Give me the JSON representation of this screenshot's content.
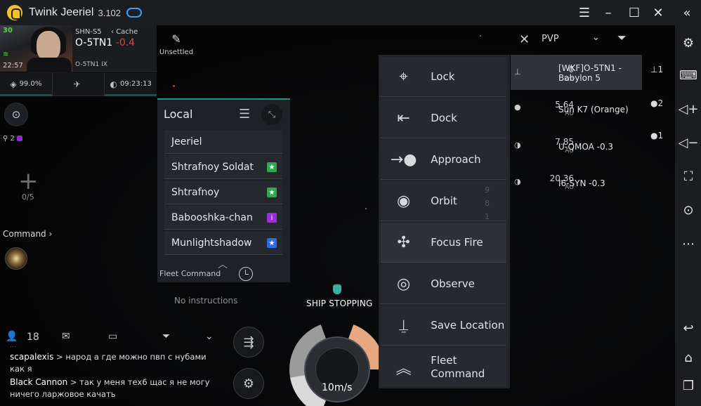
{
  "titlebar": {
    "app_name": "Twink Jeeriel",
    "version": "3.102",
    "controls": {
      "menu": "☰",
      "minimize": "–",
      "maximize": "☐",
      "close": "✕",
      "collapse": "«"
    }
  },
  "pilot": {
    "skill_points": "30",
    "corp": "SHN-S5",
    "cache_label": "Cache",
    "system": "O-5TN1",
    "security": "-0.4",
    "region": "O-5TN1 IX",
    "time": "22:57",
    "stats": [
      {
        "icon": "cargo-icon",
        "value": "99.0%"
      },
      {
        "icon": "ship-silhouette-icon",
        "value": ""
      },
      {
        "icon": "planet-icon",
        "value": "09:23:13"
      }
    ]
  },
  "unsettled": {
    "label": "Unsettled"
  },
  "fleet_indicator": {
    "count": "2"
  },
  "fleet_slots": {
    "count": "0/5"
  },
  "command": {
    "label": "Command"
  },
  "local_channel": {
    "title": "Local",
    "members": [
      {
        "name": "Jeeriel",
        "tag": "",
        "tag_color": ""
      },
      {
        "name": "Shtrafnoy Soldat",
        "tag": "★",
        "tag_color": "#2fa84f"
      },
      {
        "name": "Shtrafnoy",
        "tag": "★",
        "tag_color": "#2fa84f"
      },
      {
        "name": "Babooshka-chan",
        "tag": "i",
        "tag_color": "#9b2fd1"
      },
      {
        "name": "Munlightshadow",
        "tag": "★",
        "tag_color": "#2e6ae0"
      }
    ],
    "fleet_command_label": "Fleet Command",
    "no_instructions": "No instructions"
  },
  "chat": {
    "online_count": "18",
    "faded_line": "...",
    "messages": [
      {
        "sender": "scapalexis",
        "text": " > народ а где можно пвп с нубами как я"
      },
      {
        "sender": "Black Cannon",
        "text": " > так у меня тех6 щас я не могу ничего ларжовое качать"
      }
    ]
  },
  "hud": {
    "status": "SHIP STOPPING",
    "speed": "10m/s"
  },
  "context_menu": {
    "items": [
      {
        "label": "Lock",
        "icon": "lock-target-icon"
      },
      {
        "label": "Dock",
        "icon": "dock-icon"
      },
      {
        "label": "Approach",
        "icon": "approach-icon"
      },
      {
        "label": "Orbit",
        "icon": "orbit-icon"
      },
      {
        "label": "Focus Fire",
        "icon": "focus-fire-icon"
      },
      {
        "label": "Observe",
        "icon": "eye-icon"
      },
      {
        "label": "Save Location",
        "icon": "pin-icon"
      },
      {
        "label": "Fleet Command",
        "icon": "chevrons-icon"
      }
    ],
    "orbit_side_numbers": [
      "9",
      "8",
      "1"
    ]
  },
  "overview": {
    "filter_label": "PVP",
    "rows": [
      {
        "distance": "0",
        "unit": "km",
        "name": "[WKF]O-5TN1 - Babylon 5",
        "selected": true
      },
      {
        "distance": "5.64",
        "unit": "AU",
        "name": "Sun K7 (Orange)",
        "selected": false
      },
      {
        "distance": "7.85",
        "unit": "AU",
        "name": "U-QMOA -0.3",
        "selected": false
      },
      {
        "distance": "20.36",
        "unit": "AU",
        "name": "I6-SYN -0.3",
        "selected": false
      }
    ],
    "stack_counts": [
      "1",
      "2",
      "1"
    ]
  },
  "emulator_sidebar": {
    "icons": [
      "settings-icon",
      "keyboard-icon",
      "volume-up-icon",
      "volume-down-icon",
      "screenshot-icon",
      "record-icon",
      "more-icon",
      "back-icon",
      "home-icon",
      "recents-icon"
    ]
  }
}
